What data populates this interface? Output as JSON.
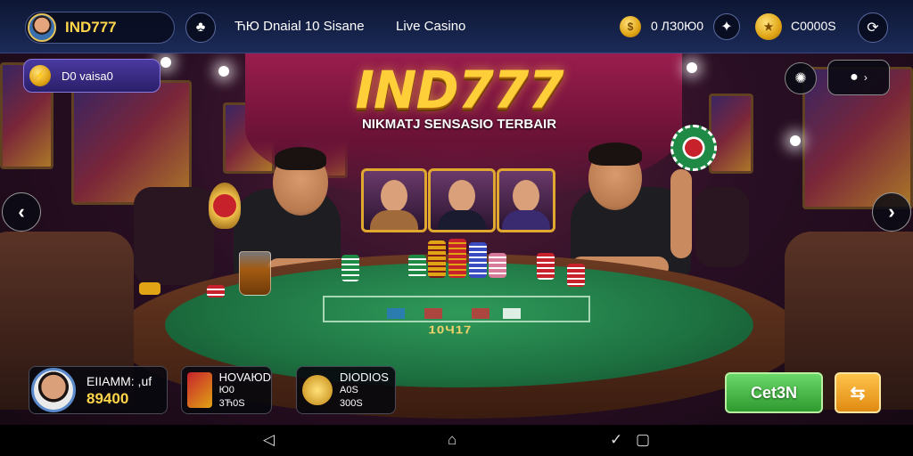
{
  "topbar": {
    "brand": "IND777",
    "menu_items": [
      "ЋЮ  Dnaial 10 Sisane",
      "Live Casino"
    ],
    "balance_left": "0 ЛЗ0Ю0",
    "balance_right": "C0000Ѕ"
  },
  "promo": {
    "label": "D0 vaisa0"
  },
  "hero": {
    "logo": "IND777",
    "tagline": "NIKMATJ SENSASIO TERBAIR"
  },
  "table": {
    "felt_text": "10Ч17"
  },
  "player_card": {
    "name": "EIIAMM: ,uf",
    "amount": "89400"
  },
  "game_cards": [
    {
      "title": "HOVAЮD",
      "line2": "Ю0",
      "line3": "3Ћ0Ѕ"
    },
    {
      "title": "DIODIOS",
      "line2": "A0S",
      "line3": "300Ѕ"
    }
  ],
  "buttons": {
    "green": "Cet3N",
    "orange": "⇆"
  },
  "icons": {
    "brand_avatar": "player-avatar-icon",
    "left_circle": "club-icon",
    "coin": "gold-coin-icon",
    "refresh": "refresh-icon",
    "nav_back": "back-icon",
    "nav_home": "home-icon",
    "nav_recent": "recent-icon"
  },
  "colors": {
    "accent_gold": "#ffd54a",
    "topbar": "#0d1633",
    "felt": "#1d7040",
    "green_button": "#2f9a2f",
    "orange_button": "#e08a12"
  }
}
